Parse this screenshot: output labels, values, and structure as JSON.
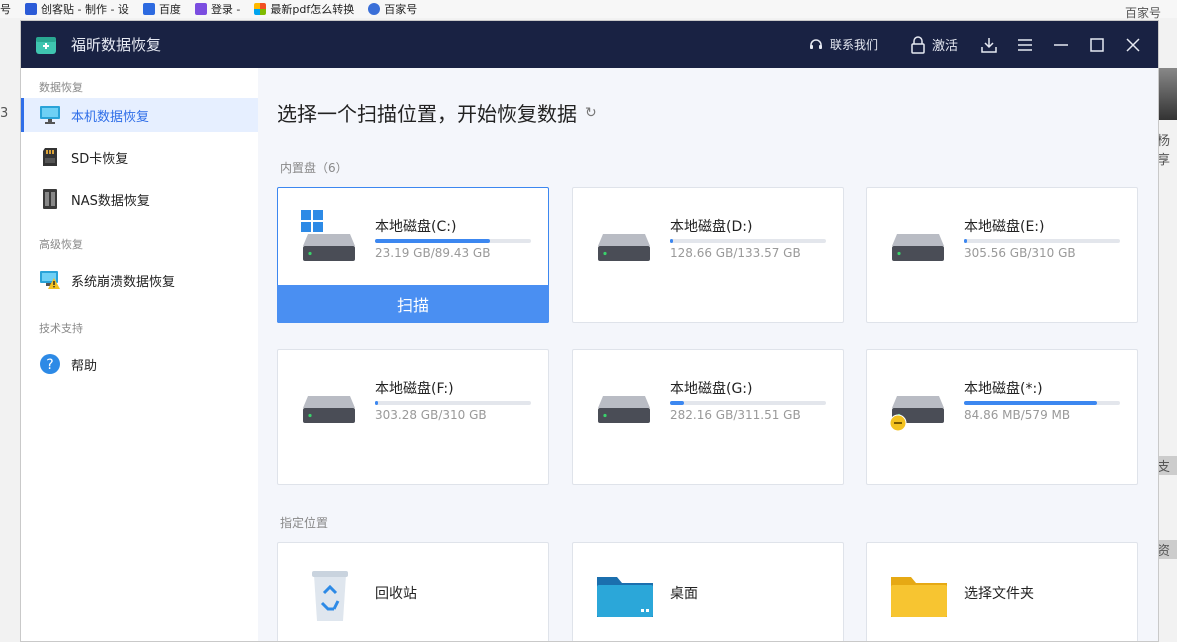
{
  "browser": {
    "bookmarks": [
      "号",
      "创客贴 - 制作 - 设",
      "百度",
      "登录 -",
      "最新pdf怎么转换",
      "百家号"
    ],
    "side_fragments": [
      "百家号",
      "3",
      "杨享",
      "支",
      "资"
    ]
  },
  "app": {
    "title": "福昕数据恢复",
    "toolbar": {
      "contact": "联系我们",
      "activate": "激活"
    }
  },
  "sidebar": {
    "sections": [
      {
        "title": "数据恢复",
        "items": [
          {
            "label": "本机数据恢复",
            "icon": "monitor-icon",
            "active": true
          },
          {
            "label": "SD卡恢复",
            "icon": "sd-card-icon",
            "active": false
          },
          {
            "label": "NAS数据恢复",
            "icon": "nas-icon",
            "active": false
          }
        ]
      },
      {
        "title": "高级恢复",
        "items": [
          {
            "label": "系统崩溃数据恢复",
            "icon": "system-crash-icon",
            "active": false
          }
        ]
      },
      {
        "title": "技术支持",
        "items": [
          {
            "label": "帮助",
            "icon": "help-icon",
            "active": false
          }
        ]
      }
    ]
  },
  "main": {
    "headline": "选择一个扫描位置，开始恢复数据",
    "internal_label": "内置盘（6）",
    "drives": [
      {
        "name": "本地磁盘(C:)",
        "size": "23.19 GB/89.43 GB",
        "used_fraction": 0.74,
        "system": true,
        "selected": true
      },
      {
        "name": "本地磁盘(D:)",
        "size": "128.66 GB/133.57 GB",
        "used_fraction": 0.02,
        "system": false,
        "selected": false
      },
      {
        "name": "本地磁盘(E:)",
        "size": "305.56 GB/310 GB",
        "used_fraction": 0.02,
        "system": false,
        "selected": false
      },
      {
        "name": "本地磁盘(F:)",
        "size": "303.28 GB/310 GB",
        "used_fraction": 0.02,
        "system": false,
        "selected": false
      },
      {
        "name": "本地磁盘(G:)",
        "size": "282.16 GB/311.51 GB",
        "used_fraction": 0.09,
        "system": false,
        "selected": false
      },
      {
        "name": "本地磁盘(*:)",
        "size": "84.86 MB/579 MB",
        "used_fraction": 0.85,
        "system": false,
        "selected": false,
        "warning": true
      }
    ],
    "scan_label": "扫描",
    "locations_label": "指定位置",
    "locations": [
      {
        "name": "回收站",
        "icon": "recycle-bin-icon"
      },
      {
        "name": "桌面",
        "icon": "desktop-folder-icon"
      },
      {
        "name": "选择文件夹",
        "icon": "folder-icon"
      }
    ]
  },
  "colors": {
    "titlebar": "#192243",
    "accent": "#3c87f0",
    "scan_button": "#4a8ff2"
  }
}
